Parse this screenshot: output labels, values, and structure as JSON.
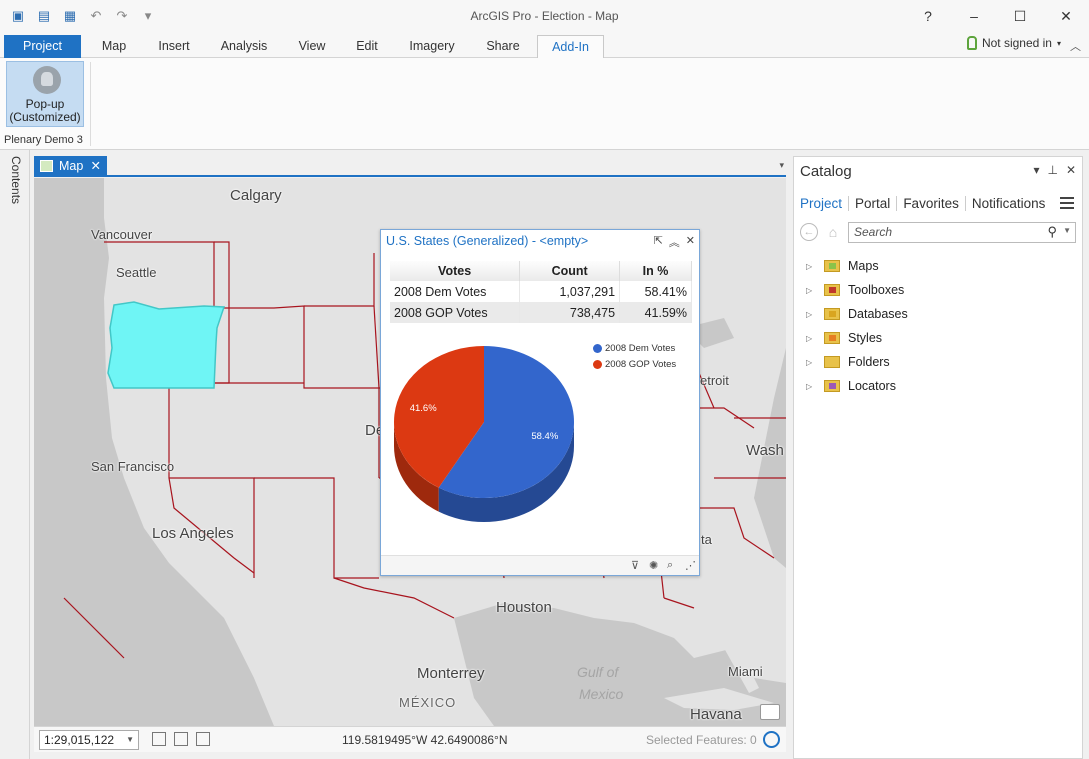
{
  "window": {
    "title": "ArcGIS Pro - Election - Map",
    "controls": [
      "?",
      "–",
      "☐",
      "✕"
    ]
  },
  "ribbon": {
    "tabs": [
      "Project",
      "Map",
      "Insert",
      "Analysis",
      "View",
      "Edit",
      "Imagery",
      "Share",
      "Add-In"
    ],
    "active_tab": "Add-In",
    "signin": "Not signed in",
    "button_label_1": "Pop-up",
    "button_label_2": "(Customized)",
    "group_label": "Plenary Demo 3"
  },
  "side": {
    "contents_label": "Contents"
  },
  "map": {
    "tab_label": "Map",
    "labels": {
      "calgary": "Calgary",
      "vancouver": "Vancouver",
      "seattle": "Seattle",
      "san_francisco": "San Francisco",
      "los_angeles": "Los Angeles",
      "houston": "Houston",
      "monterrey": "Monterrey",
      "mexico": "MÉXICO",
      "gulf": "Gulf of",
      "gulf2": "Mexico",
      "miami": "Miami",
      "havana": "Havana",
      "detroit": "etroit",
      "denver": "De",
      "washington": "Wash",
      "atlanta": "ta"
    },
    "colors": {
      "land": "#e3e3e3",
      "water": "#c8c8c8",
      "boundary": "#a8141e",
      "highlight": "#6ff5f5"
    }
  },
  "statusbar": {
    "scale": "1:29,015,122",
    "coords": "119.5819495°W 42.6490086°N",
    "selected": "Selected Features: 0"
  },
  "popup": {
    "title": "U.S. States (Generalized) - <empty>",
    "headers": [
      "Votes",
      "Count",
      "In %"
    ],
    "rows": [
      [
        "2008 Dem Votes",
        "1,037,291",
        "58.41%"
      ],
      [
        "2008 GOP Votes",
        "738,475",
        "41.59%"
      ]
    ]
  },
  "chart_data": {
    "type": "pie",
    "title": "",
    "categories": [
      "2008 Dem Votes",
      "2008 GOP Votes"
    ],
    "values": [
      58.4,
      41.6
    ],
    "labels": [
      "58.4%",
      "41.6%"
    ],
    "colors": [
      "#3366cc",
      "#dc3912"
    ],
    "legend_position": "top-right"
  },
  "catalog": {
    "title": "Catalog",
    "tabs": [
      "Project",
      "Portal",
      "Favorites",
      "Notifications"
    ],
    "search_placeholder": "Search",
    "items": [
      "Maps",
      "Toolboxes",
      "Databases",
      "Styles",
      "Folders",
      "Locators"
    ]
  }
}
